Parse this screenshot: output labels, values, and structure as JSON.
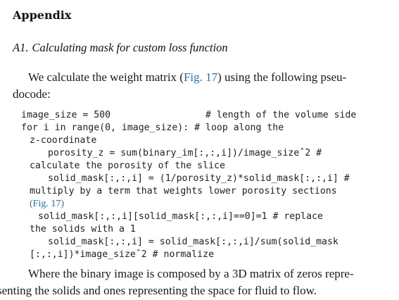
{
  "section": {
    "title": "Appendix"
  },
  "subsection": {
    "number": "A1.",
    "title": "Calculating mask for custom loss function"
  },
  "intro": {
    "line1_a": "We calculate the weight matrix (",
    "line1_ref": "Fig. 17",
    "line1_b": ") using the following pseu-",
    "line2": "docode:"
  },
  "code": {
    "l1": "image_size = 500                 # length of the volume side",
    "l2": "for i in range(0, image_size): # loop along the",
    "l3": "z-coordinate",
    "l4": "porosity_z = sum(binary_im[:,:,i])/image_sizeˆ2 #",
    "l5": "calculate the porosity of the slice",
    "l6": "solid_mask[:,:,i] = (1/porosity_z)*solid_mask[:,:,i] #",
    "l7": "multiply by a term that weights lower porosity sections",
    "l8_ref": "(Fig. 17)",
    "l9": "solid_mask[:,:,i][solid_mask[:,:,i]==0]=1 # replace",
    "l10": "the solids with a 1",
    "l11": "solid_mask[:,:,i] = solid_mask[:,:,i]/sum(solid_mask",
    "l12": "[:,:,i])*image_sizeˆ2 # normalize"
  },
  "outro": {
    "line1": "Where the binary image is composed by a 3D matrix of zeros repre-",
    "line2": "senting the solids and ones representing the space for fluid to flow."
  },
  "colors": {
    "link": "#2a6fb0",
    "text": "#1a1a1a"
  }
}
